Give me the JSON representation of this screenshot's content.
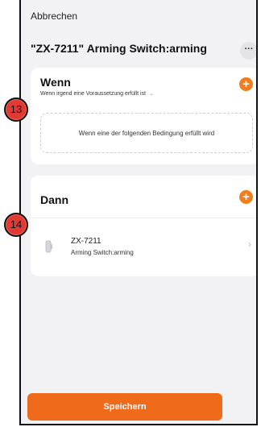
{
  "header": {
    "cancel_label": "Abbrechen",
    "title": "\"ZX-7211\" Arming Switch:arming",
    "more_label": "···"
  },
  "wenn": {
    "title": "Wenn",
    "subtitle": "Wenn irgend eine Voraussetzung erfüllt ist",
    "subtitle_chevron": "⌄",
    "add_label": "+",
    "condition_placeholder": "Wenn eine der folgenden Bedingung erfüllt wird"
  },
  "dann": {
    "title": "Dann",
    "add_label": "+",
    "device": {
      "name": "ZX-7211",
      "subtitle": "Arming Switch:arming",
      "chevron": "›"
    }
  },
  "footer": {
    "save_label": "Speichern"
  },
  "markers": {
    "m13": "13",
    "m14": "14"
  },
  "colors": {
    "accent": "#f06a1c",
    "marker": "#e13a35"
  }
}
